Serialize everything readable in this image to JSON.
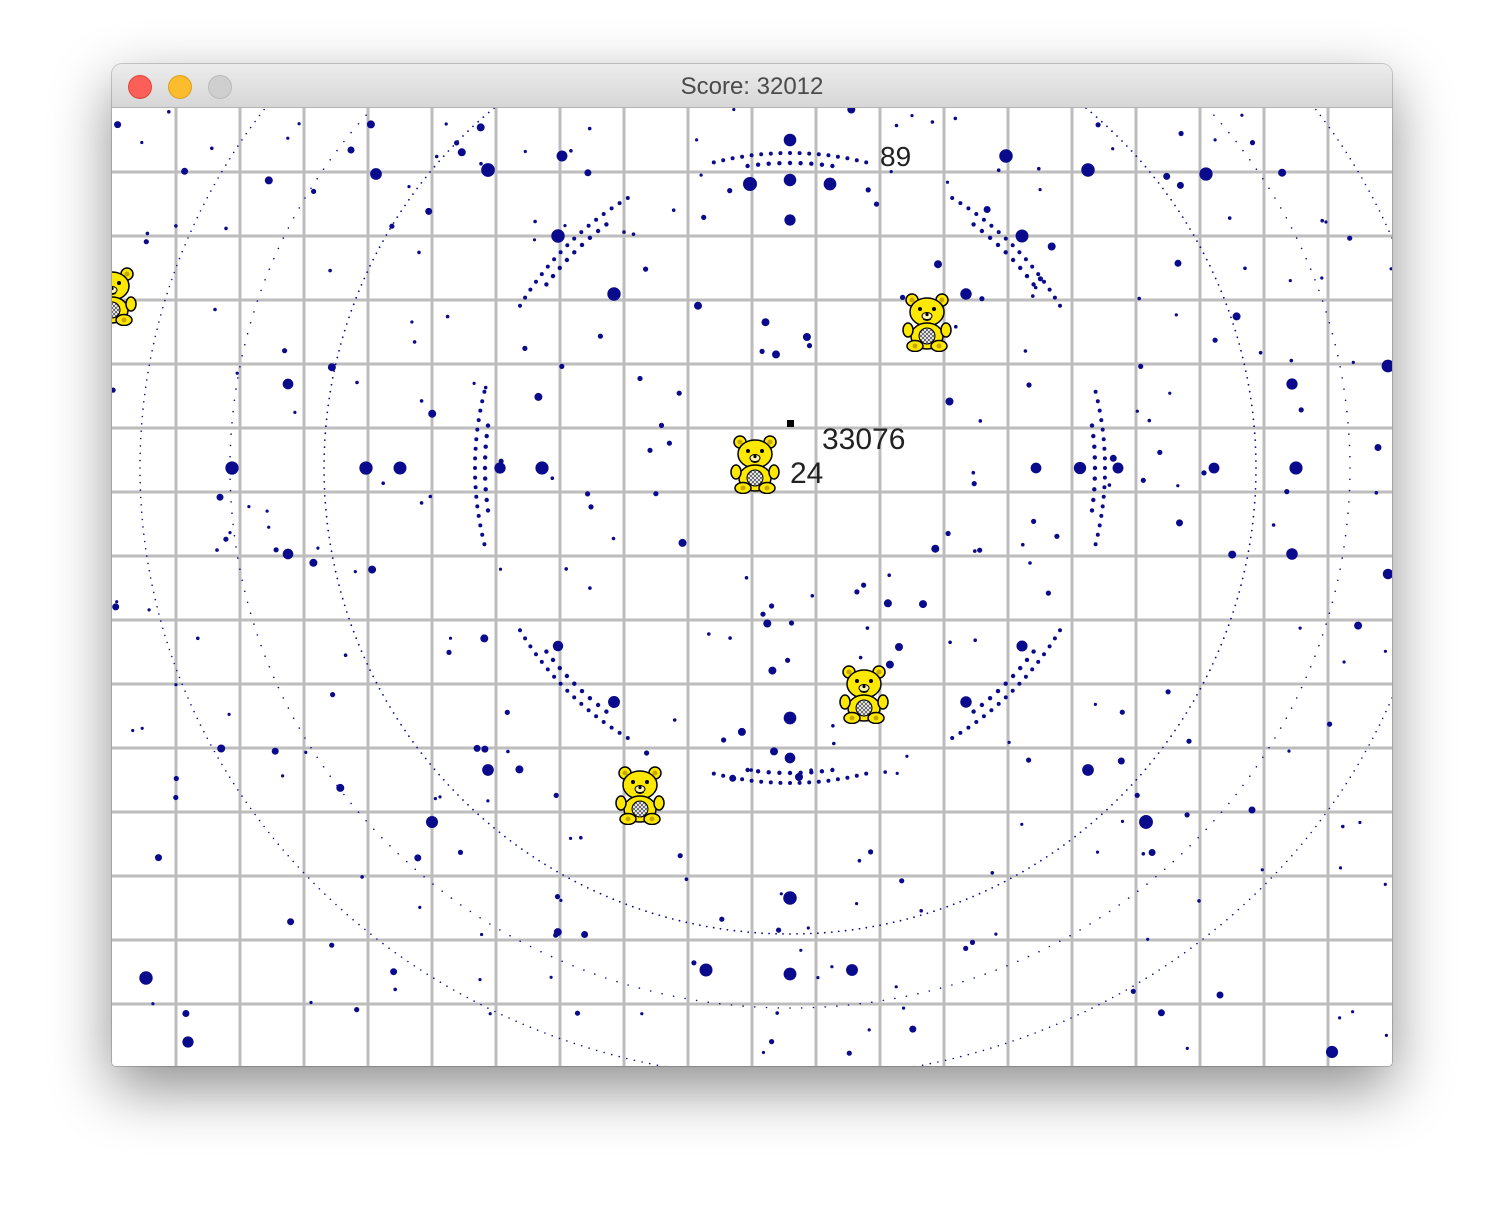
{
  "window": {
    "title": "Score: 32012"
  },
  "game": {
    "labels": {
      "center_number": "33076",
      "bear_number": "24",
      "top_number": "89"
    },
    "colors": {
      "grid": "#bdbdbd",
      "dot": "#0a0a8c",
      "bear_fill": "#ffe800",
      "bear_outline": "#000000"
    },
    "bears": [
      {
        "name": "player-bear"
      },
      {
        "name": "enemy-bear"
      },
      {
        "name": "enemy-bear"
      },
      {
        "name": "enemy-bear"
      },
      {
        "name": "enemy-bear"
      }
    ]
  }
}
